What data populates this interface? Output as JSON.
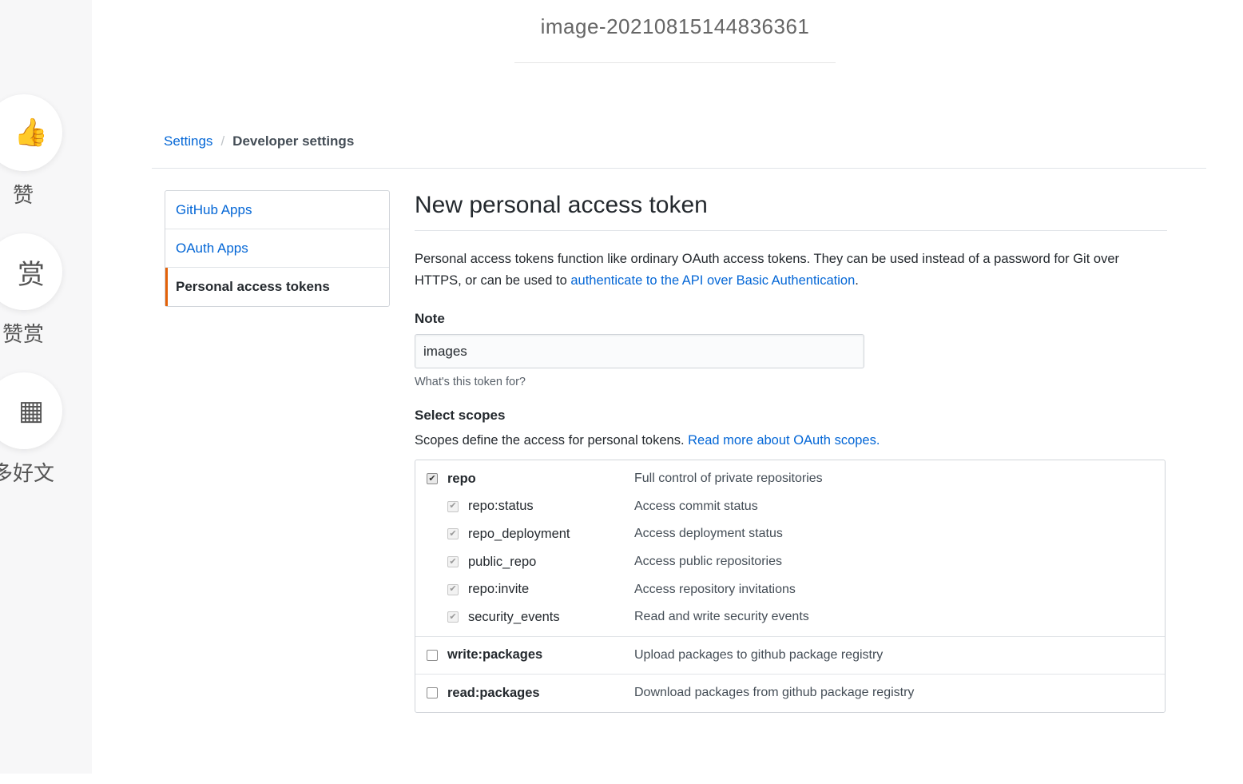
{
  "page_title": "image-20210815144836361",
  "sidebar_actions": [
    {
      "icon": "thumbs-up-icon",
      "glyph": "👍",
      "label": "赞"
    },
    {
      "icon": "reward-icon",
      "glyph": "赏",
      "label": "赞赏"
    },
    {
      "icon": "qr-code-icon",
      "glyph": "▦",
      "label": "多好文"
    }
  ],
  "breadcrumb": {
    "settings": "Settings",
    "separator": "/",
    "current": "Developer settings"
  },
  "menu": {
    "items": [
      "GitHub Apps",
      "OAuth Apps",
      "Personal access tokens"
    ],
    "active": "Personal access tokens"
  },
  "main": {
    "heading": "New personal access token",
    "desc_prefix": "Personal access tokens function like ordinary OAuth access tokens. They can be used instead of a password for Git over HTTPS, or can be used to ",
    "desc_link": "authenticate to the API over Basic Authentication",
    "desc_suffix": ".",
    "note_label": "Note",
    "note_value": "images",
    "note_help": "What's this token for?",
    "scopes_label": "Select scopes",
    "scopes_desc_prefix": "Scopes define the access for personal tokens. ",
    "scopes_desc_link": "Read more about OAuth scopes."
  },
  "scopes": [
    {
      "name": "repo",
      "desc": "Full control of private repositories",
      "checked": true,
      "children": [
        {
          "name": "repo:status",
          "desc": "Access commit status",
          "checked": true
        },
        {
          "name": "repo_deployment",
          "desc": "Access deployment status",
          "checked": true
        },
        {
          "name": "public_repo",
          "desc": "Access public repositories",
          "checked": true
        },
        {
          "name": "repo:invite",
          "desc": "Access repository invitations",
          "checked": true
        },
        {
          "name": "security_events",
          "desc": "Read and write security events",
          "checked": true
        }
      ]
    },
    {
      "name": "write:packages",
      "desc": "Upload packages to github package registry",
      "checked": false,
      "children": []
    },
    {
      "name": "read:packages",
      "desc": "Download packages from github package registry",
      "checked": false,
      "children": []
    }
  ],
  "colors": {
    "link": "#0366d6",
    "active_marker": "#e36209"
  }
}
